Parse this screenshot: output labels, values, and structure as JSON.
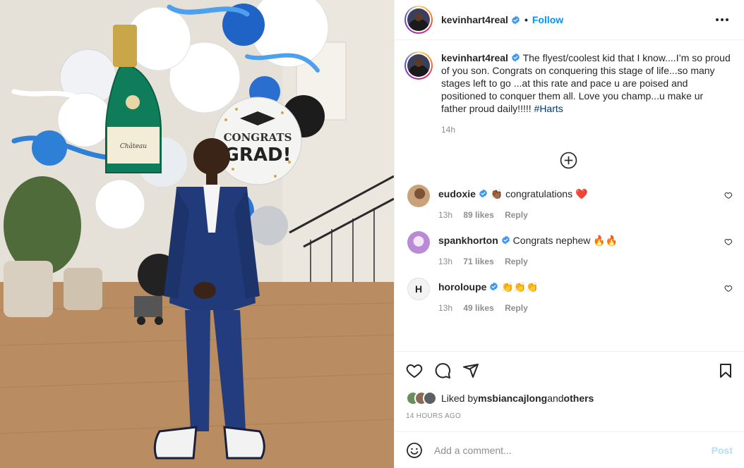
{
  "post": {
    "author": {
      "username": "kevinhart4real",
      "verified": true,
      "follow_label": "Follow"
    },
    "caption": {
      "text": "The flyest/coolest kid that I know....I’m so proud of you son. Congrats on conquering this stage of life...so many stages left to go ...at this rate and pace u are poised and positioned to conquer them all. Love you champ...u make ur father proud daily!!!!! ",
      "hashtag": "#Harts",
      "age": "14h"
    },
    "comments": [
      {
        "username": "eudoxie",
        "verified": true,
        "text": "👏🏾 congratulations ❤️",
        "age": "13h",
        "likes": "89 likes",
        "reply": "Reply",
        "avatar_color": "#c9a27a"
      },
      {
        "username": "spankhorton",
        "verified": true,
        "text": "Congrats nephew 🔥🔥",
        "age": "13h",
        "likes": "71 likes",
        "reply": "Reply",
        "avatar_color": "#b98ad6"
      },
      {
        "username": "horoloupe",
        "verified": true,
        "text": "👏👏👏",
        "age": "13h",
        "likes": "49 likes",
        "reply": "Reply",
        "avatar_color": "#eeeeee"
      }
    ],
    "likes": {
      "prefix": "Liked by ",
      "user": "msbiancajlong",
      "middle": " and ",
      "others": "others"
    },
    "timestamp": "14 HOURS AGO",
    "add_comment": {
      "placeholder": "Add a comment...",
      "post_label": "Post"
    }
  },
  "colors": {
    "link": "#0095f6",
    "hashtag": "#00376b",
    "muted": "#8e8e8e",
    "verified": "#3897f0"
  }
}
